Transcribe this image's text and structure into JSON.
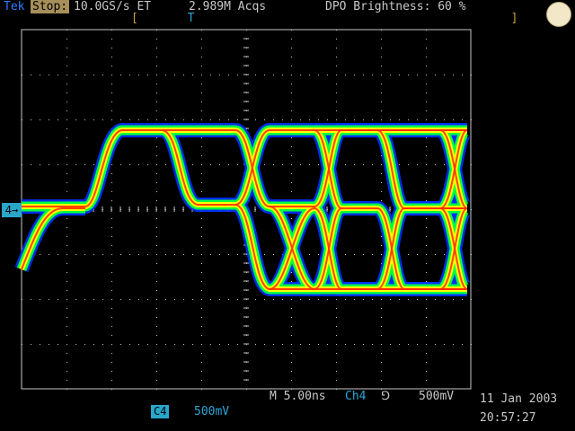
{
  "status_bar": {
    "brand": "Tek",
    "state": "Stop:",
    "sample_rate": "10.0GS/s ET",
    "acquisitions": "2.989M Acqs",
    "brightness": "DPO Brightness: 60 %"
  },
  "trigger_position": {
    "left_bracket": "[",
    "marker": "T",
    "right_bracket": "]"
  },
  "channel_marker": "4",
  "footer": {
    "timebase": "M 5.00ns",
    "trigger_channel": "Ch4",
    "trigger_slope": "⅁",
    "trigger_level": "500mV",
    "channel_badge": "C4",
    "channel_scale": "500mV",
    "date": "11 Jan 2003",
    "time": "20:57:27"
  },
  "colors": {
    "grid": "#c8c8c8",
    "trace_core": "#ff3000",
    "trace_mid": "#ffff00",
    "trace_edge": "#00ff40",
    "trace_halo": "#0030ff",
    "channel": "#29a7c9"
  },
  "icons": [
    "knob-icon",
    "trigger-slope-icon"
  ]
}
